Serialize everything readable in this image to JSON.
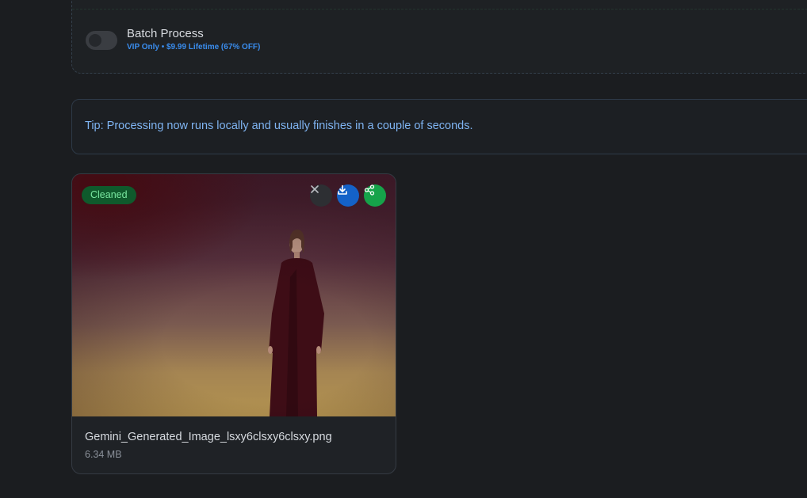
{
  "batch": {
    "label": "Batch Process",
    "subtitle": "VIP Only • $9.99 Lifetime (67% OFF)",
    "enabled": false
  },
  "tip": {
    "text": "Tip: Processing now runs locally and usually finishes in a couple of seconds."
  },
  "result_card": {
    "badge": "Cleaned",
    "file_name": "Gemini_Generated_Image_lsxy6clsxy6clsxy.png",
    "file_size": "6.34 MB",
    "actions": [
      {
        "name": "remove",
        "icon": "close-icon"
      },
      {
        "name": "download",
        "icon": "download-icon"
      },
      {
        "name": "share",
        "icon": "share-icon"
      }
    ]
  },
  "colors": {
    "background": "#1b1d20",
    "accent_blue": "#3a8dee",
    "badge_green": "#0f5a2c",
    "download_blue": "#1462c8",
    "share_green": "#16a34a"
  }
}
